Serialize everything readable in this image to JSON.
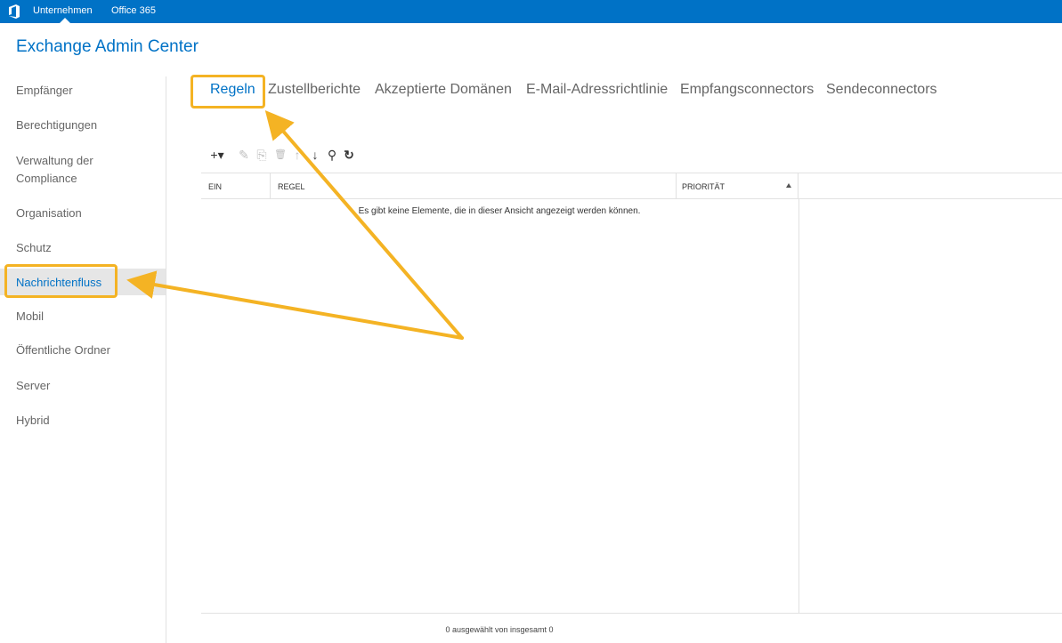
{
  "topbar": {
    "links": [
      "Unternehmen",
      "Office 365"
    ],
    "logo_icon": "office-logo-icon",
    "color": "#0072c6"
  },
  "app": {
    "title": "Exchange Admin Center"
  },
  "sidebar": {
    "items": [
      {
        "label": "Empfänger"
      },
      {
        "label": "Berechtigungen"
      },
      {
        "label": "Verwaltung der Compliance"
      },
      {
        "label": "Organisation"
      },
      {
        "label": "Schutz"
      },
      {
        "label": "Nachrichtenfluss",
        "selected": true
      },
      {
        "label": "Mobil"
      },
      {
        "label": "Öffentliche Ordner"
      },
      {
        "label": "Server"
      },
      {
        "label": "Hybrid"
      }
    ]
  },
  "tabs": [
    {
      "label": "Regeln",
      "active": true
    },
    {
      "label": "Zustellberichte"
    },
    {
      "label": "Akzeptierte Domänen"
    },
    {
      "label": "E-Mail-Adressrichtlinie"
    },
    {
      "label": "Empfangsconnectors"
    },
    {
      "label": "Sendeconnectors"
    }
  ],
  "toolbar": {
    "icons": [
      {
        "name": "add-icon",
        "glyph": "+▾",
        "enabled": true
      },
      {
        "name": "edit-icon",
        "glyph": "✎",
        "enabled": false
      },
      {
        "name": "copy-icon",
        "glyph": "⎘",
        "enabled": false
      },
      {
        "name": "delete-icon",
        "glyph": "🗑",
        "enabled": false
      },
      {
        "name": "move-up-icon",
        "glyph": "↑",
        "enabled": false
      },
      {
        "name": "move-down-icon",
        "glyph": "↓",
        "enabled": true
      },
      {
        "name": "search-icon",
        "glyph": "⚲",
        "enabled": true
      },
      {
        "name": "refresh-icon",
        "glyph": "↻",
        "enabled": true
      }
    ]
  },
  "grid": {
    "columns": [
      "EIN",
      "REGEL",
      "PRIORITÄT"
    ],
    "sort_column": "PRIORITÄT",
    "sort_direction": "ascending",
    "empty_message": "Es gibt keine Elemente, die in dieser Ansicht angezeigt werden können.",
    "status": "0 ausgewählt von insgesamt 0"
  },
  "annotations": {
    "color": "#f4b324",
    "highlighted": [
      "Regeln",
      "Nachrichtenfluss"
    ]
  }
}
